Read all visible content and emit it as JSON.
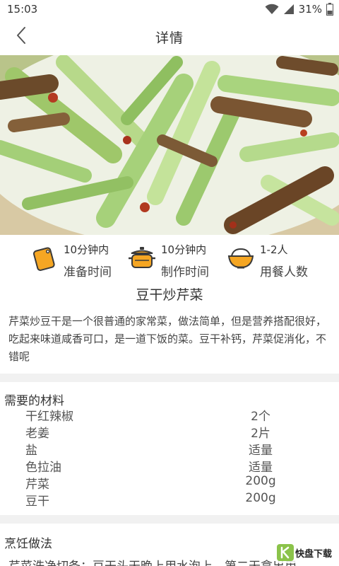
{
  "status_bar": {
    "time": "15:03",
    "battery": "31%"
  },
  "header": {
    "title": "详情"
  },
  "info": [
    {
      "value": "10分钟内",
      "label": "准备时间"
    },
    {
      "value": "10分钟内",
      "label": "制作时间"
    },
    {
      "value": "1-2人",
      "label": "用餐人数"
    }
  ],
  "dish": {
    "name": "豆干炒芹菜",
    "description": "芹菜炒豆干是一个很普通的家常菜，做法简单，但是营养搭配很好，吃起来味道咸香可口，是一道下饭的菜。豆干补钙，芹菜促消化，不错呢"
  },
  "ingredients": {
    "title": "需要的材料",
    "items": [
      {
        "name": "干红辣椒",
        "qty": "2个"
      },
      {
        "name": "老姜",
        "qty": "2片"
      },
      {
        "name": "盐",
        "qty": "适量"
      },
      {
        "name": "色拉油",
        "qty": "适量"
      },
      {
        "name": "芹菜",
        "qty": "200g"
      },
      {
        "name": "豆干",
        "qty": "200g"
      }
    ]
  },
  "method": {
    "title": "烹饪做法",
    "first_step": "芹菜洗净切条；豆干头天晚上用水泡上，第二天拿出用"
  },
  "watermark": {
    "text": "快盘下载"
  },
  "colors": {
    "icon_orange": "#f5a623",
    "divider": "#f1f1f1"
  }
}
